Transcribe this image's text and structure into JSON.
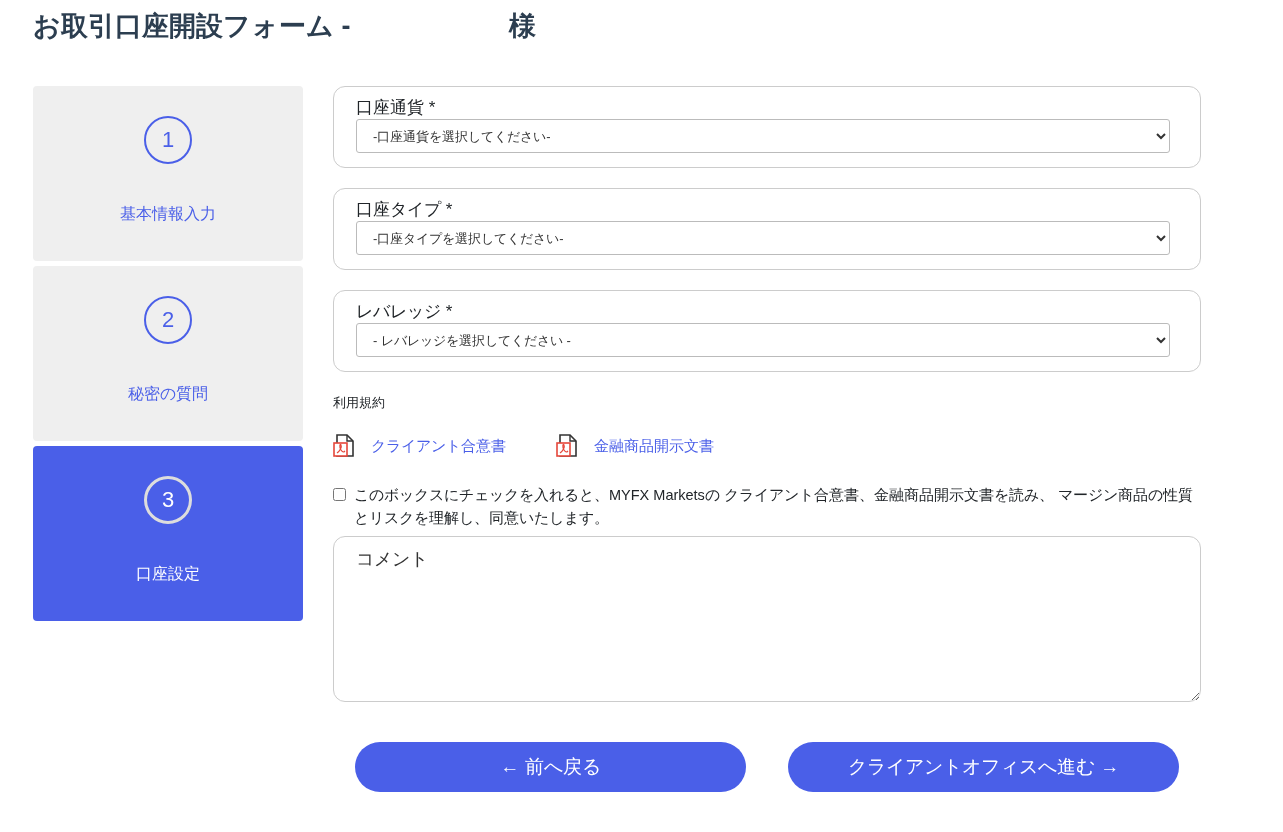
{
  "title": {
    "text": "お取引口座開設フォーム -",
    "suffix": "様"
  },
  "steps": [
    {
      "number": "1",
      "label": "基本情報入力",
      "selected": false
    },
    {
      "number": "2",
      "label": "秘密の質問",
      "selected": false
    },
    {
      "number": "3",
      "label": "口座設定",
      "selected": true
    }
  ],
  "fields": [
    {
      "label": "口座通貨 *",
      "value": "-口座通貨を選択してください-"
    },
    {
      "label": "口座タイプ *",
      "value": "-口座タイプを選択してください-"
    },
    {
      "label": "レバレッジ *",
      "value": "- レバレッジを選択してください -"
    }
  ],
  "terms": {
    "heading": "利用規約",
    "documents": [
      "クライアント合意書",
      "金融商品開示文書"
    ]
  },
  "agreement": {
    "checked": false,
    "text": "このボックスにチェックを入れると、MYFX Marketsの クライアント合意書、金融商品開示文書を読み、 マージン商品の性質とリスクを理解し、同意いたします。"
  },
  "comment": {
    "placeholder": "コメント"
  },
  "buttons": [
    "← 前へ戻る",
    "クライアントオフィスへ進む →"
  ]
}
